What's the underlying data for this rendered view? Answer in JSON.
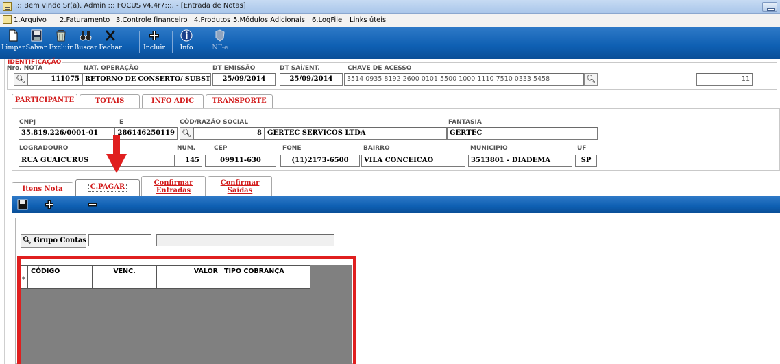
{
  "window": {
    "title": ".:: Bem vindo Sr(a). Admin ::: FOCUS v4.4r7:::.  - [Entrada de Notas]"
  },
  "menu": [
    "1.Arquivo",
    "2.Faturamento",
    "3.Controle financeiro",
    "4.Produtos",
    "5.Módulos Adicionais",
    "6.LogFile",
    "Links úteis"
  ],
  "toolbar": [
    {
      "label": "Limpar",
      "icon": "new-document-icon"
    },
    {
      "label": "Salvar",
      "icon": "floppy-disk-icon"
    },
    {
      "label": "Excluir",
      "icon": "trash-icon"
    },
    {
      "label": "Buscar",
      "icon": "binoculars-icon"
    },
    {
      "label": "Fechar",
      "icon": "close-x-icon"
    },
    {
      "label": "Incluir",
      "icon": "plus-icon"
    },
    {
      "label": "Info",
      "icon": "info-icon"
    },
    {
      "label": "NF-e",
      "icon": "nfe-icon"
    }
  ],
  "identificacao": {
    "group_label": "IDENTIFICAÇÃO",
    "nro_nota_label": "Nro. NOTA",
    "nro_nota": "111075",
    "nat_operacao_label": "NAT. OPERAÇÃO",
    "nat_operacao": "RETORNO DE CONSERTO/ SUBST",
    "dt_emissao_label": "DT EMISSÃO",
    "dt_emissao": "25/09/2014",
    "dt_sai_label": "DT SAÍ/ENT.",
    "dt_sai": "25/09/2014",
    "chave_label": "CHAVE DE ACESSO",
    "chave": "3514 0935 8192 2600 0101 5500 1000 1110 7510 0333 5458",
    "extra_value": "11"
  },
  "tabs_top": [
    "PARTICIPANTE",
    "TOTAIS",
    "INFO ADIC",
    "TRANSPORTE"
  ],
  "participante": {
    "cnpj_label": "CNPJ",
    "cnpj": "35.819.226/0001-01",
    "ie_label_partial": "E",
    "ie": "286146250119",
    "cod_razao_label": "CÓD/RAZÃO SOCIAL",
    "cod": "8",
    "razao": "GERTEC SERVICOS LTDA",
    "fantasia_label": "FANTASIA",
    "fantasia": "GERTEC",
    "logradouro_label": "LOGRADOURO",
    "logradouro": "RUA GUAICURUS",
    "num_label": "NUM.",
    "num": "145",
    "cep_label": "CEP",
    "cep": "09911-630",
    "fone_label": "FONE",
    "fone": "(11)2173-6500",
    "bairro_label": "BAIRRO",
    "bairro": "VILA CONCEICAO",
    "municipio_label": "MUNICIPIO",
    "municipio": "3513801 - DIADEMA",
    "uf_label": "UF",
    "uf": "SP"
  },
  "tabs_bottom": [
    {
      "line1": "Itens Nota",
      "line2": ""
    },
    {
      "line1": "C.PAGAR",
      "line2": ""
    },
    {
      "line1": "Confirmar",
      "line2": "Entradas"
    },
    {
      "line1": "Confirmar",
      "line2": "Saídas"
    }
  ],
  "cpagar": {
    "grupo_button": "Grupo Contas",
    "grupo_value": "",
    "grupo_desc": "",
    "grid_headers": [
      "CÓDIGO",
      "VENC.",
      "VALOR",
      "TIPO COBRANÇA"
    ],
    "new_row_marker": "*"
  },
  "colors": {
    "toolbar_blue": "#0e5fb2",
    "tab_red": "#d21c1c",
    "annotation_red": "#e01f1f",
    "grid_bg": "#808080"
  }
}
